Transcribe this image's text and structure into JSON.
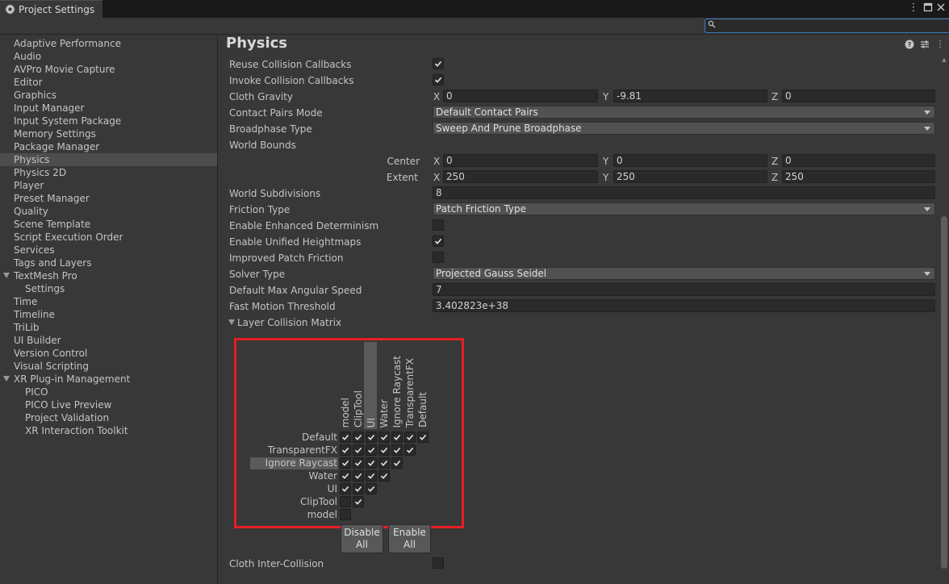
{
  "window": {
    "tab_title": "Project Settings",
    "controls": [
      "more-icon",
      "maximize-icon",
      "close-icon"
    ]
  },
  "search": {
    "placeholder": "",
    "value": ""
  },
  "sidebar": {
    "items": [
      {
        "label": "Adaptive Performance"
      },
      {
        "label": "Audio"
      },
      {
        "label": "AVPro Movie Capture"
      },
      {
        "label": "Editor"
      },
      {
        "label": "Graphics"
      },
      {
        "label": "Input Manager"
      },
      {
        "label": "Input System Package"
      },
      {
        "label": "Memory Settings"
      },
      {
        "label": "Package Manager"
      },
      {
        "label": "Physics",
        "selected": true
      },
      {
        "label": "Physics 2D"
      },
      {
        "label": "Player"
      },
      {
        "label": "Preset Manager"
      },
      {
        "label": "Quality"
      },
      {
        "label": "Scene Template"
      },
      {
        "label": "Script Execution Order"
      },
      {
        "label": "Services"
      },
      {
        "label": "Tags and Layers"
      },
      {
        "label": "TextMesh Pro",
        "expanded": true
      },
      {
        "label": "Settings",
        "child": true
      },
      {
        "label": "Time"
      },
      {
        "label": "Timeline"
      },
      {
        "label": "TriLib"
      },
      {
        "label": "UI Builder"
      },
      {
        "label": "Version Control"
      },
      {
        "label": "Visual Scripting"
      },
      {
        "label": "XR Plug-in Management",
        "expanded": true
      },
      {
        "label": "PICO",
        "child": true
      },
      {
        "label": "PICO Live Preview",
        "child": true
      },
      {
        "label": "Project Validation",
        "child": true
      },
      {
        "label": "XR Interaction Toolkit",
        "child": true
      }
    ]
  },
  "main": {
    "title": "Physics",
    "header_icons": [
      "help-icon",
      "preset-icon",
      "kebab-menu-icon"
    ],
    "settings": {
      "reuse_collision_callbacks": {
        "label": "Reuse Collision Callbacks",
        "checked": true
      },
      "invoke_collision_callbacks": {
        "label": "Invoke Collision Callbacks",
        "checked": true
      },
      "cloth_gravity": {
        "label": "Cloth Gravity",
        "x": "0",
        "y": "-9.81",
        "z": "0"
      },
      "contact_pairs_mode": {
        "label": "Contact Pairs Mode",
        "value": "Default Contact Pairs"
      },
      "broadphase_type": {
        "label": "Broadphase Type",
        "value": "Sweep And Prune Broadphase"
      },
      "world_bounds": {
        "label": "World Bounds",
        "center": {
          "label": "Center",
          "x": "0",
          "y": "0",
          "z": "0"
        },
        "extent": {
          "label": "Extent",
          "x": "250",
          "y": "250",
          "z": "250"
        }
      },
      "world_subdivisions": {
        "label": "World Subdivisions",
        "value": "8"
      },
      "friction_type": {
        "label": "Friction Type",
        "value": "Patch Friction Type"
      },
      "enhanced_determinism": {
        "label": "Enable Enhanced Determinism",
        "checked": false
      },
      "unified_heightmaps": {
        "label": "Enable Unified Heightmaps",
        "checked": true
      },
      "improved_patch_friction": {
        "label": "Improved Patch Friction",
        "checked": false
      },
      "solver_type": {
        "label": "Solver Type",
        "value": "Projected Gauss Seidel"
      },
      "default_max_angular_speed": {
        "label": "Default Max Angular Speed",
        "value": "7"
      },
      "fast_motion_threshold": {
        "label": "Fast Motion Threshold",
        "value": "3.402823e+38"
      },
      "cloth_inter_collision": {
        "label": "Cloth Inter-Collision",
        "checked": false
      }
    },
    "axis_labels": {
      "x": "X",
      "y": "Y",
      "z": "Z"
    },
    "layer_collision_matrix": {
      "label": "Layer Collision Matrix",
      "column_layers": [
        "model",
        "ClipTool",
        "UI",
        "Water",
        "Ignore Raycast",
        "TransparentFX",
        "Default"
      ],
      "row_layers": [
        "Default",
        "TransparentFX",
        "Ignore Raycast",
        "Water",
        "UI",
        "ClipTool",
        "model"
      ],
      "highlighted_row": "Ignore Raycast",
      "highlighted_column": "ClipTool",
      "matrix": [
        [
          true,
          true,
          true,
          true,
          true,
          true,
          true
        ],
        [
          true,
          true,
          true,
          true,
          true,
          true
        ],
        [
          true,
          true,
          true,
          true,
          true
        ],
        [
          true,
          true,
          true,
          true
        ],
        [
          true,
          true,
          true
        ],
        [
          false,
          true
        ],
        [
          false
        ]
      ],
      "disable_all_label": [
        "Disable",
        "All"
      ],
      "enable_all_label": [
        "Enable",
        "All"
      ]
    },
    "accent_color": "#e61e25"
  }
}
